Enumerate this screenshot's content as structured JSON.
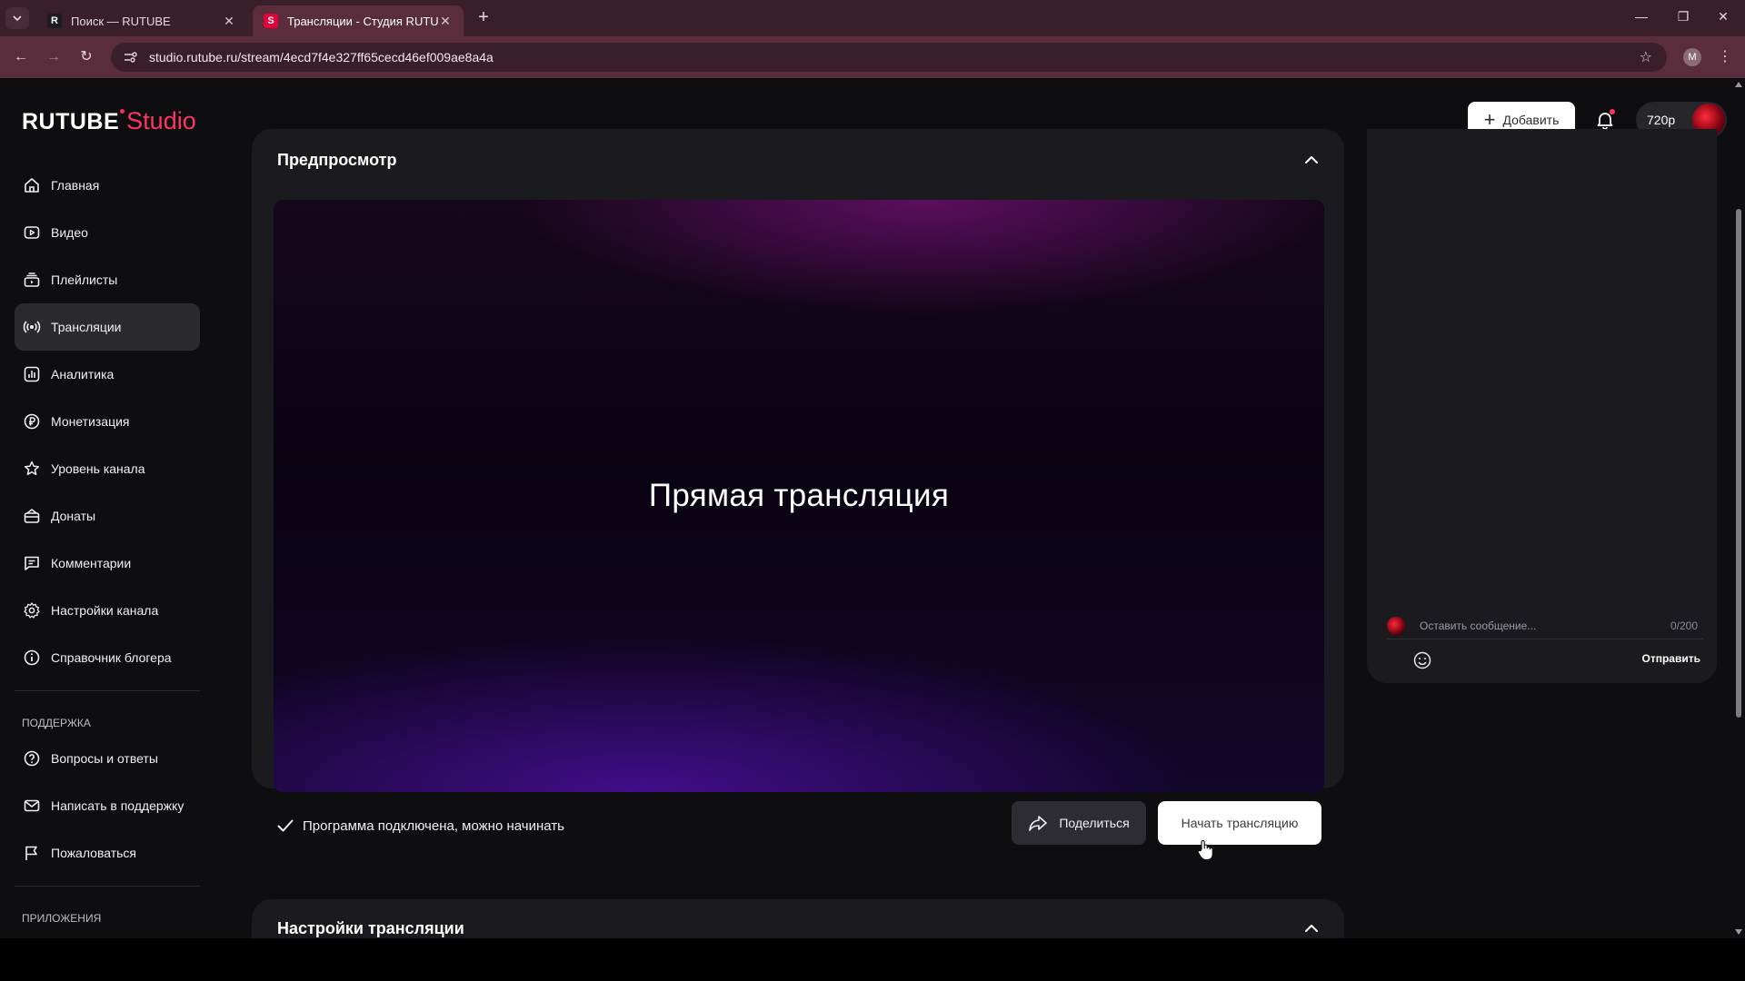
{
  "browser": {
    "tabs": [
      {
        "favicon": "R",
        "title": "Поиск — RUTUBE",
        "active": false
      },
      {
        "favicon": "S",
        "title": "Трансляции - Студия RUTUBE",
        "active": true
      }
    ],
    "url": "studio.rutube.ru/stream/4ecd7f4e327ff65cecd46ef009ae8a4a",
    "profile_initial": "M"
  },
  "header": {
    "logo_main": "RUTUBE",
    "logo_studio": "Studio",
    "add_label": "Добавить",
    "quality_label": "720p"
  },
  "sidebar": {
    "items": [
      {
        "label": "Главная",
        "icon": "home-icon"
      },
      {
        "label": "Видео",
        "icon": "video-icon"
      },
      {
        "label": "Плейлисты",
        "icon": "playlists-icon"
      },
      {
        "label": "Трансляции",
        "icon": "broadcast-icon",
        "active": true
      },
      {
        "label": "Аналитика",
        "icon": "analytics-icon"
      },
      {
        "label": "Монетизация",
        "icon": "ruble-icon"
      },
      {
        "label": "Уровень канала",
        "icon": "star-icon"
      },
      {
        "label": "Донаты",
        "icon": "gift-icon"
      },
      {
        "label": "Комментарии",
        "icon": "comment-icon"
      },
      {
        "label": "Настройки канала",
        "icon": "gear-icon"
      },
      {
        "label": "Справочник блогера",
        "icon": "info-icon"
      }
    ],
    "support_heading": "ПОДДЕРЖКА",
    "support_items": [
      {
        "label": "Вопросы и ответы",
        "icon": "question-icon"
      },
      {
        "label": "Написать в поддержку",
        "icon": "mail-icon"
      },
      {
        "label": "Пожаловаться",
        "icon": "flag-icon"
      }
    ],
    "apps_heading": "ПРИЛОЖЕНИЯ"
  },
  "preview_card": {
    "title": "Предпросмотр",
    "preview_text": "Прямая трансляция",
    "status_text": "Программа подключена, можно начинать",
    "share_label": "Поделиться",
    "start_label": "Начать трансляцию"
  },
  "settings_card": {
    "title": "Настройки трансляции"
  },
  "chat": {
    "placeholder": "Оставить сообщение...",
    "counter": "0/200",
    "send_label": "Отправить"
  },
  "colors": {
    "accent": "#ff3466",
    "app_bg": "#0e0e10",
    "card_bg": "#1b1b1f",
    "browser_frame": "#5a2d3c"
  }
}
